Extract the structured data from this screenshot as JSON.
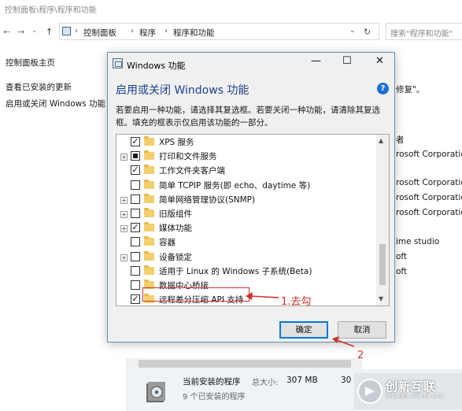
{
  "explorer": {
    "title": "控制面板\\程序\\程序和功能",
    "nav": {
      "back": "←",
      "forward": "→",
      "recent": "⌄",
      "up": "↑"
    },
    "breadcrumb": [
      "控制面板",
      "程序",
      "程序和功能"
    ],
    "breadcrumb_sep": "›",
    "refresh": "↻",
    "dropdown": "⌄",
    "search_placeholder": "搜索\"程序和功能\"",
    "sidebar": {
      "home": "控制面板主页",
      "view_updates": "查看已安装的更新",
      "toggle_features": "启用或关闭 Windows 功能"
    },
    "right_fragments": [
      "修复\"。",
      "者",
      "rosoft Corporation",
      "rosoft Corporation",
      "rosoft Corporation",
      "rosoft Corporation",
      "ime studio",
      "oft",
      "oft"
    ]
  },
  "dialog": {
    "title": "Windows 功能",
    "controls": {
      "minimize": "—",
      "maximize": "☐",
      "close": "✕"
    },
    "header": "启用或关闭 Windows 功能",
    "help": "?",
    "description": "若要启用一种功能，请选择其复选框。若要关闭一种功能，请清除其复选框。填充的框表示仅启用该功能的一部分。",
    "features": [
      {
        "label": "XPS 服务",
        "state": "checked",
        "expandable": false
      },
      {
        "label": "打印和文件服务",
        "state": "partial",
        "expandable": true
      },
      {
        "label": "工作文件夹客户端",
        "state": "checked",
        "expandable": false
      },
      {
        "label": "简单 TCPIP 服务(即 echo、daytime 等)",
        "state": "unchecked",
        "expandable": false
      },
      {
        "label": "简单网络管理协议(SNMP)",
        "state": "unchecked",
        "expandable": true
      },
      {
        "label": "旧版组件",
        "state": "unchecked",
        "expandable": true
      },
      {
        "label": "媒体功能",
        "state": "checked",
        "expandable": true
      },
      {
        "label": "容器",
        "state": "unchecked",
        "expandable": false
      },
      {
        "label": "设备锁定",
        "state": "unchecked",
        "expandable": true
      },
      {
        "label": "适用于 Linux 的 Windows 子系统(Beta)",
        "state": "unchecked",
        "expandable": false
      },
      {
        "label": "数据中心桥接",
        "state": "unchecked",
        "expandable": false
      },
      {
        "label": "远程差分压缩 API 支持",
        "state": "checked",
        "expandable": false
      }
    ],
    "scroll_up": "▲",
    "scroll_down": "▼",
    "ok": "确定",
    "cancel": "取消"
  },
  "annotations": {
    "step1": "1.去勾",
    "step2": "2"
  },
  "installed": {
    "title": "当前安装的程序",
    "size_label": "总大小:",
    "size_value": "307 MB",
    "count": "9 个已安装的程序",
    "year_fragment": "30"
  },
  "watermark": {
    "name": "创新互联",
    "sub": "CHUANG XIN HU LIAN"
  },
  "colors": {
    "annotation": "#d0312d",
    "accent": "#0078d7",
    "header": "#1f3f8f"
  }
}
